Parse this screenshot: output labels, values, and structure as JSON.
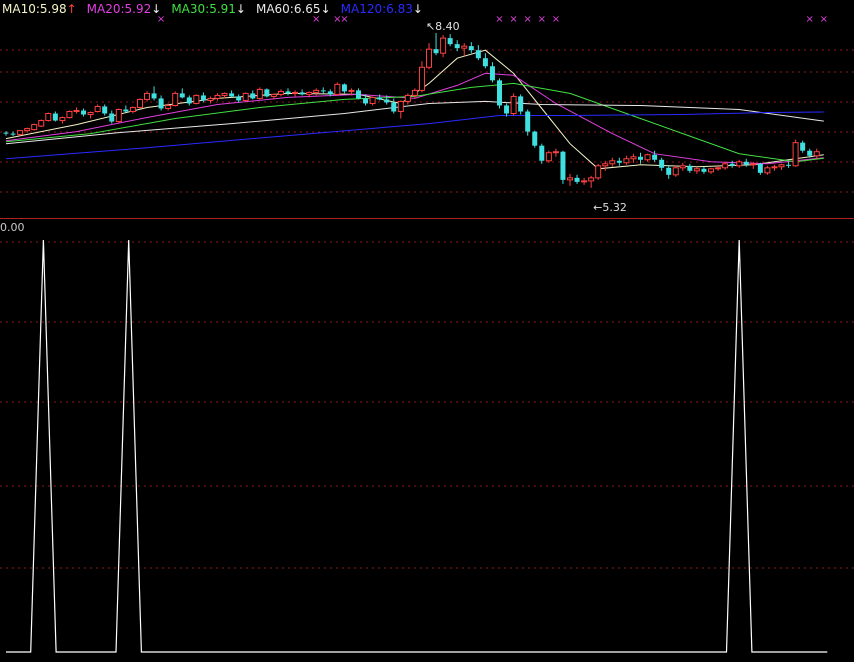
{
  "legend": [
    {
      "label": "MA10:5.98",
      "arrow": "↑",
      "color": "#f5f5c8",
      "arrow_color": "#ff4040"
    },
    {
      "label": "MA20:5.92",
      "arrow": "↓",
      "color": "#e040e0",
      "arrow_color": "#f0f0f0"
    },
    {
      "label": "MA30:5.91",
      "arrow": "↓",
      "color": "#40e040",
      "arrow_color": "#f0f0f0"
    },
    {
      "label": "MA60:6.65",
      "arrow": "↓",
      "color": "#e8e8e8",
      "arrow_color": "#f0f0f0"
    },
    {
      "label": "MA120:6.83",
      "arrow": "↓",
      "color": "#2a2aff",
      "arrow_color": "#f0f0f0"
    }
  ],
  "annotations": {
    "high": "8.40",
    "low": "5.32"
  },
  "indicator": {
    "label": "0.00"
  },
  "colors": {
    "up": "#ff4040",
    "down": "#40e0e0",
    "grid": "#8b1a1a",
    "divider": "#b02020",
    "marker": "#e040e0",
    "indicator_line": "#ffffff"
  },
  "chart_data": {
    "type": "candlestick",
    "price_range": [
      5.0,
      8.7
    ],
    "indicator_range": [
      0,
      1
    ],
    "candles": [
      [
        6.42,
        6.45,
        6.36,
        6.4
      ],
      [
        6.4,
        6.44,
        6.35,
        6.38
      ],
      [
        6.38,
        6.47,
        6.36,
        6.46
      ],
      [
        6.46,
        6.52,
        6.42,
        6.5
      ],
      [
        6.48,
        6.6,
        6.46,
        6.58
      ],
      [
        6.55,
        6.68,
        6.53,
        6.66
      ],
      [
        6.66,
        6.82,
        6.64,
        6.8
      ],
      [
        6.8,
        6.84,
        6.64,
        6.66
      ],
      [
        6.66,
        6.74,
        6.6,
        6.72
      ],
      [
        6.72,
        6.86,
        6.7,
        6.84
      ],
      [
        6.84,
        6.92,
        6.8,
        6.86
      ],
      [
        6.86,
        6.9,
        6.74,
        6.78
      ],
      [
        6.78,
        6.84,
        6.7,
        6.82
      ],
      [
        6.84,
        6.98,
        6.82,
        6.94
      ],
      [
        6.94,
        6.98,
        6.76,
        6.8
      ],
      [
        6.8,
        6.86,
        6.6,
        6.64
      ],
      [
        6.64,
        6.9,
        6.62,
        6.88
      ],
      [
        6.88,
        6.96,
        6.82,
        6.84
      ],
      [
        6.84,
        6.94,
        6.8,
        6.92
      ],
      [
        6.92,
        7.1,
        6.9,
        7.08
      ],
      [
        7.08,
        7.24,
        7.04,
        7.2
      ],
      [
        7.2,
        7.34,
        7.06,
        7.1
      ],
      [
        7.1,
        7.16,
        6.86,
        6.9
      ],
      [
        6.9,
        7.0,
        6.86,
        6.96
      ],
      [
        6.96,
        7.24,
        6.94,
        7.2
      ],
      [
        7.2,
        7.3,
        7.1,
        7.12
      ],
      [
        7.12,
        7.16,
        6.96,
        7.0
      ],
      [
        7.0,
        7.18,
        6.98,
        7.16
      ],
      [
        7.16,
        7.22,
        7.02,
        7.06
      ],
      [
        7.06,
        7.14,
        7.0,
        7.1
      ],
      [
        7.1,
        7.2,
        7.06,
        7.16
      ],
      [
        7.16,
        7.22,
        7.1,
        7.2
      ],
      [
        7.2,
        7.26,
        7.12,
        7.14
      ],
      [
        7.14,
        7.18,
        7.02,
        7.06
      ],
      [
        7.06,
        7.22,
        7.04,
        7.2
      ],
      [
        7.2,
        7.26,
        7.08,
        7.1
      ],
      [
        7.1,
        7.32,
        7.08,
        7.28
      ],
      [
        7.28,
        7.3,
        7.12,
        7.14
      ],
      [
        7.14,
        7.2,
        7.08,
        7.18
      ],
      [
        7.18,
        7.28,
        7.14,
        7.24
      ],
      [
        7.24,
        7.3,
        7.16,
        7.2
      ],
      [
        7.2,
        7.26,
        7.14,
        7.22
      ],
      [
        7.22,
        7.28,
        7.16,
        7.18
      ],
      [
        7.18,
        7.24,
        7.12,
        7.22
      ],
      [
        7.22,
        7.3,
        7.16,
        7.26
      ],
      [
        7.26,
        7.32,
        7.2,
        7.24
      ],
      [
        7.24,
        7.28,
        7.14,
        7.18
      ],
      [
        7.18,
        7.42,
        7.16,
        7.38
      ],
      [
        7.38,
        7.4,
        7.2,
        7.24
      ],
      [
        7.24,
        7.3,
        7.16,
        7.26
      ],
      [
        7.26,
        7.3,
        7.08,
        7.1
      ],
      [
        7.1,
        7.18,
        6.96,
        7.0
      ],
      [
        7.0,
        7.14,
        6.96,
        7.12
      ],
      [
        7.12,
        7.18,
        7.06,
        7.08
      ],
      [
        7.08,
        7.16,
        6.98,
        7.02
      ],
      [
        7.02,
        7.1,
        6.8,
        6.84
      ],
      [
        6.84,
        7.06,
        6.7,
        7.04
      ],
      [
        7.04,
        7.2,
        6.98,
        7.16
      ],
      [
        7.16,
        7.3,
        7.1,
        7.26
      ],
      [
        7.26,
        7.84,
        7.22,
        7.72
      ],
      [
        7.72,
        8.2,
        7.68,
        8.08
      ],
      [
        8.08,
        8.4,
        7.96,
        8.0
      ],
      [
        8.0,
        8.36,
        7.92,
        8.3
      ],
      [
        8.3,
        8.38,
        8.14,
        8.18
      ],
      [
        8.18,
        8.26,
        8.04,
        8.1
      ],
      [
        8.1,
        8.2,
        7.94,
        8.14
      ],
      [
        8.14,
        8.22,
        8.0,
        8.06
      ],
      [
        8.06,
        8.16,
        7.86,
        7.9
      ],
      [
        7.9,
        8.0,
        7.7,
        7.74
      ],
      [
        7.74,
        7.82,
        7.42,
        7.46
      ],
      [
        7.46,
        7.5,
        6.9,
        6.96
      ],
      [
        6.96,
        7.0,
        6.74,
        6.8
      ],
      [
        6.8,
        7.2,
        6.76,
        7.14
      ],
      [
        7.14,
        7.18,
        6.78,
        6.84
      ],
      [
        6.84,
        6.88,
        6.36,
        6.44
      ],
      [
        6.44,
        6.46,
        6.12,
        6.16
      ],
      [
        6.16,
        6.2,
        5.8,
        5.86
      ],
      [
        5.86,
        6.06,
        5.82,
        6.02
      ],
      [
        6.02,
        6.1,
        5.94,
        6.04
      ],
      [
        6.04,
        6.06,
        5.4,
        5.48
      ],
      [
        5.48,
        5.6,
        5.36,
        5.52
      ],
      [
        5.52,
        5.58,
        5.4,
        5.44
      ],
      [
        5.44,
        5.52,
        5.38,
        5.46
      ],
      [
        5.46,
        5.56,
        5.32,
        5.52
      ],
      [
        5.52,
        5.8,
        5.48,
        5.76
      ],
      [
        5.76,
        5.86,
        5.66,
        5.8
      ],
      [
        5.8,
        5.92,
        5.74,
        5.86
      ],
      [
        5.86,
        5.92,
        5.76,
        5.82
      ],
      [
        5.82,
        5.96,
        5.78,
        5.9
      ],
      [
        5.9,
        6.0,
        5.82,
        5.94
      ],
      [
        5.94,
        6.02,
        5.8,
        5.88
      ],
      [
        5.88,
        6.0,
        5.84,
        5.98
      ],
      [
        5.98,
        6.06,
        5.84,
        5.88
      ],
      [
        5.88,
        5.92,
        5.66,
        5.72
      ],
      [
        5.72,
        5.76,
        5.5,
        5.58
      ],
      [
        5.58,
        5.76,
        5.54,
        5.72
      ],
      [
        5.72,
        5.82,
        5.66,
        5.76
      ],
      [
        5.76,
        5.8,
        5.62,
        5.66
      ],
      [
        5.66,
        5.74,
        5.6,
        5.7
      ],
      [
        5.7,
        5.74,
        5.6,
        5.64
      ],
      [
        5.64,
        5.72,
        5.6,
        5.7
      ],
      [
        5.7,
        5.78,
        5.66,
        5.72
      ],
      [
        5.72,
        5.84,
        5.68,
        5.8
      ],
      [
        5.8,
        5.86,
        5.72,
        5.76
      ],
      [
        5.76,
        5.88,
        5.72,
        5.84
      ],
      [
        5.84,
        5.9,
        5.74,
        5.78
      ],
      [
        5.78,
        5.84,
        5.7,
        5.8
      ],
      [
        5.8,
        5.82,
        5.58,
        5.62
      ],
      [
        5.62,
        5.76,
        5.58,
        5.72
      ],
      [
        5.72,
        5.78,
        5.66,
        5.74
      ],
      [
        5.74,
        5.8,
        5.68,
        5.78
      ],
      [
        5.78,
        5.84,
        5.72,
        5.76
      ],
      [
        5.76,
        6.28,
        5.74,
        6.22
      ],
      [
        6.22,
        6.26,
        6.02,
        6.06
      ],
      [
        6.06,
        6.1,
        5.92,
        5.96
      ],
      [
        5.96,
        6.1,
        5.9,
        6.04
      ]
    ],
    "ma_lines": [
      {
        "name": "MA10",
        "color": "#f5f5c8",
        "points": [
          [
            0,
            6.3
          ],
          [
            10,
            6.58
          ],
          [
            20,
            6.92
          ],
          [
            30,
            7.1
          ],
          [
            40,
            7.2
          ],
          [
            50,
            7.18
          ],
          [
            56,
            7.0
          ],
          [
            60,
            7.4
          ],
          [
            64,
            7.9
          ],
          [
            68,
            8.06
          ],
          [
            72,
            7.6
          ],
          [
            76,
            6.9
          ],
          [
            80,
            6.2
          ],
          [
            84,
            5.7
          ],
          [
            90,
            5.78
          ],
          [
            98,
            5.74
          ],
          [
            106,
            5.78
          ],
          [
            116,
            5.98
          ]
        ]
      },
      {
        "name": "MA20",
        "color": "#e040e0",
        "points": [
          [
            0,
            6.26
          ],
          [
            10,
            6.44
          ],
          [
            20,
            6.72
          ],
          [
            30,
            6.98
          ],
          [
            40,
            7.12
          ],
          [
            50,
            7.18
          ],
          [
            58,
            7.1
          ],
          [
            64,
            7.36
          ],
          [
            68,
            7.6
          ],
          [
            72,
            7.56
          ],
          [
            78,
            7.0
          ],
          [
            86,
            6.4
          ],
          [
            92,
            6.0
          ],
          [
            100,
            5.84
          ],
          [
            108,
            5.8
          ],
          [
            116,
            5.92
          ]
        ]
      },
      {
        "name": "MA30",
        "color": "#40e040",
        "points": [
          [
            0,
            6.24
          ],
          [
            12,
            6.4
          ],
          [
            24,
            6.7
          ],
          [
            36,
            6.92
          ],
          [
            48,
            7.08
          ],
          [
            58,
            7.14
          ],
          [
            66,
            7.32
          ],
          [
            72,
            7.4
          ],
          [
            80,
            7.2
          ],
          [
            88,
            6.8
          ],
          [
            96,
            6.4
          ],
          [
            104,
            6.0
          ],
          [
            112,
            5.84
          ],
          [
            116,
            5.91
          ]
        ]
      },
      {
        "name": "MA60",
        "color": "#e8e8e8",
        "points": [
          [
            0,
            6.2
          ],
          [
            16,
            6.42
          ],
          [
            32,
            6.6
          ],
          [
            48,
            6.8
          ],
          [
            60,
            7.0
          ],
          [
            68,
            7.04
          ],
          [
            76,
            6.98
          ],
          [
            90,
            6.96
          ],
          [
            104,
            6.88
          ],
          [
            116,
            6.65
          ]
        ]
      },
      {
        "name": "MA120",
        "color": "#2a2aff",
        "points": [
          [
            0,
            5.9
          ],
          [
            20,
            6.12
          ],
          [
            40,
            6.36
          ],
          [
            60,
            6.6
          ],
          [
            70,
            6.76
          ],
          [
            80,
            6.76
          ],
          [
            96,
            6.78
          ],
          [
            108,
            6.82
          ],
          [
            116,
            6.83
          ]
        ]
      }
    ],
    "markers": {
      "symbol": "×",
      "indices": [
        22,
        44,
        47,
        48,
        70,
        72,
        74,
        76,
        78,
        114,
        116
      ]
    },
    "indicator_series": [
      [
        0,
        0
      ],
      [
        3.5,
        0
      ],
      [
        5.3,
        1
      ],
      [
        7.1,
        0
      ],
      [
        15.6,
        0
      ],
      [
        17.4,
        1
      ],
      [
        19.2,
        0
      ],
      [
        102.2,
        0
      ],
      [
        104.0,
        1
      ],
      [
        105.8,
        0
      ],
      [
        116.5,
        0
      ]
    ]
  }
}
